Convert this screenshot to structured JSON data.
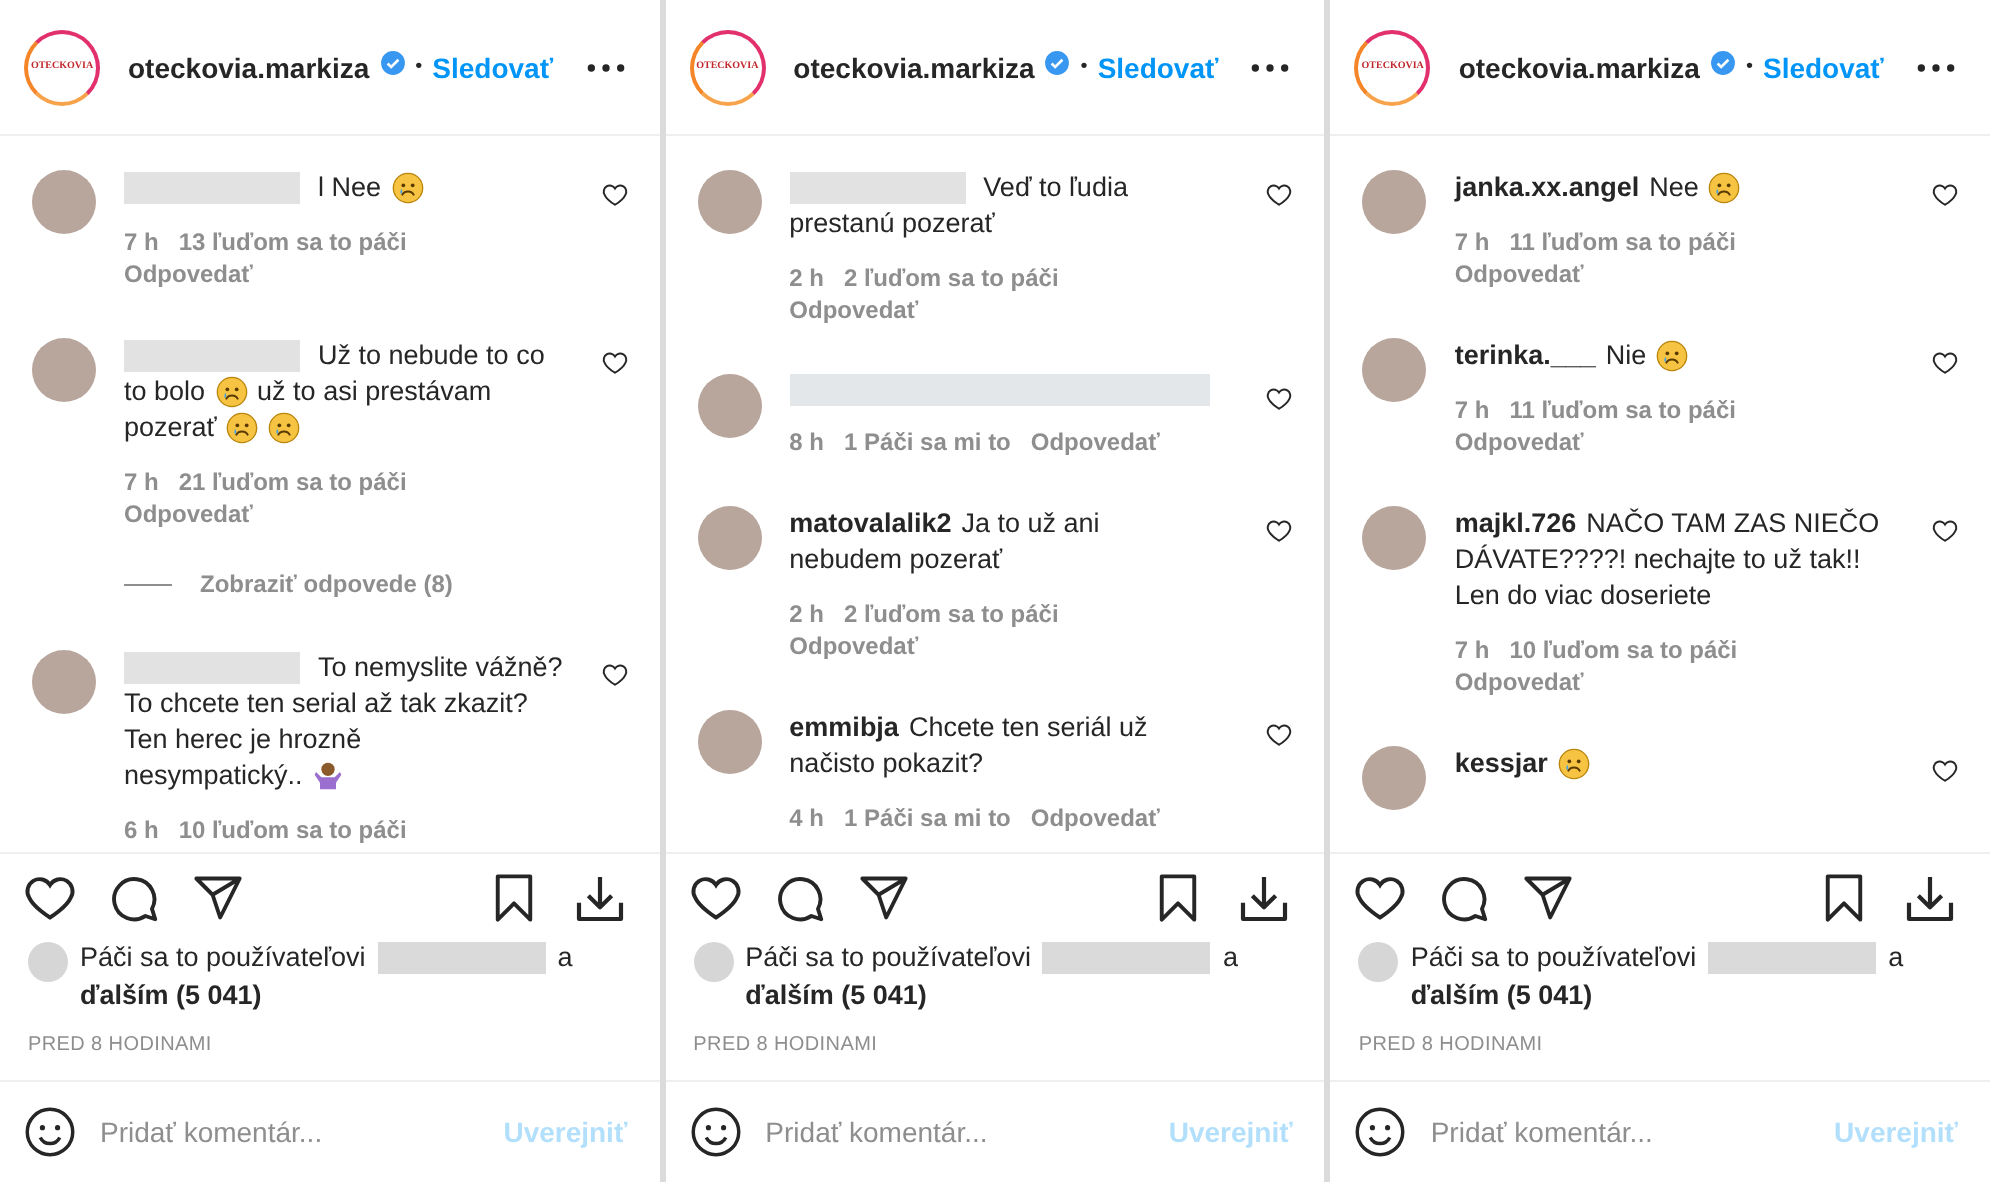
{
  "panels": [
    {
      "header": {
        "logo_text": "OTECKOVIA",
        "username": "oteckovia.markiza",
        "verified": true,
        "separator": "•",
        "follow": "Sledovať"
      },
      "comments": [
        {
          "author_hidden": true,
          "lines": [
            [
              {
                "kind": "text",
                "text": "l Nee"
              },
              {
                "kind": "emoji"
              }
            ]
          ],
          "time": "7 h",
          "likes": "13 ľuďom sa to páči",
          "reply": "Odpovedať"
        },
        {
          "author_hidden": true,
          "lines": [
            [
              {
                "kind": "text",
                "text": "Už to nebude to co"
              }
            ],
            [
              {
                "kind": "text",
                "text": "to bolo"
              },
              {
                "kind": "emoji"
              },
              {
                "kind": "text",
                "text": "už to asi prestávam"
              }
            ],
            [
              {
                "kind": "text",
                "text": "pozerať"
              },
              {
                "kind": "emoji"
              },
              {
                "kind": "emoji"
              }
            ]
          ],
          "time": "7 h",
          "likes": "21 ľuďom sa to páči",
          "reply": "Odpovedať",
          "view_replies": "Zobraziť odpovede (8)"
        },
        {
          "author_hidden": true,
          "lines": [
            [
              {
                "kind": "text",
                "text": "To nemyslite vážně?"
              }
            ],
            [
              {
                "kind": "text",
                "text": "To chcete ten serial až tak zkazit?"
              }
            ],
            [
              {
                "kind": "text",
                "text": "Ten herec je hrozně"
              }
            ],
            [
              {
                "kind": "text",
                "text": "nesympatický.."
              },
              {
                "kind": "gesture"
              }
            ]
          ],
          "time": "6 h",
          "likes": "10 ľuďom sa to páči"
        }
      ],
      "likes": {
        "prefix": "Páči sa to používateľovi",
        "joiner": "a",
        "count": "ďalším (5 041)"
      },
      "timestamp": "PRED 8 HODINAMI",
      "comment_placeholder": "Pridať komentár...",
      "post": "Uverejniť"
    },
    {
      "header": {
        "logo_text": "OTECKOVIA",
        "username": "oteckovia.markiza",
        "verified": true,
        "separator": "•",
        "follow": "Sledovať"
      },
      "comments": [
        {
          "author_hidden": true,
          "lines": [
            [
              {
                "kind": "text",
                "text": "Veď to ľudia"
              }
            ],
            [
              {
                "kind": "text",
                "text": "prestanú pozerať"
              }
            ]
          ],
          "time": "2 h",
          "likes": "2 ľuďom sa to páči",
          "reply": "Odpovedať"
        },
        {
          "author_hidden": true,
          "text_hidden": true,
          "time": "8 h",
          "likes": "1 Páči sa mi to",
          "reply": "Odpovedať"
        },
        {
          "author": "matovalalik2",
          "lines": [
            [
              {
                "kind": "text",
                "text": "Ja to už ani"
              }
            ],
            [
              {
                "kind": "text",
                "text": "nebudem pozerať"
              }
            ]
          ],
          "time": "2 h",
          "likes": "2 ľuďom sa to páči",
          "reply": "Odpovedať"
        },
        {
          "author": "emmibja",
          "lines": [
            [
              {
                "kind": "text",
                "text": "Chcete ten seriál už"
              }
            ],
            [
              {
                "kind": "text",
                "text": "načisto pokazit?"
              }
            ]
          ],
          "time": "4 h",
          "likes": "1 Páči sa mi to",
          "reply": "Odpovedať"
        }
      ],
      "likes": {
        "prefix": "Páči sa to používateľovi",
        "joiner": "a",
        "count": "ďalším (5 041)"
      },
      "timestamp": "PRED 8 HODINAMI",
      "comment_placeholder": "Pridať komentár...",
      "post": "Uverejniť"
    },
    {
      "header": {
        "logo_text": "OTECKOVIA",
        "username": "oteckovia.markiza",
        "verified": true,
        "separator": "•",
        "follow": "Sledovať"
      },
      "comments": [
        {
          "author": "janka.xx.angel",
          "lines": [
            [
              {
                "kind": "text",
                "text": "Nee"
              },
              {
                "kind": "emoji"
              }
            ]
          ],
          "time": "7 h",
          "likes": "11 ľuďom sa to páči",
          "reply": "Odpovedať"
        },
        {
          "author": "terinka.___",
          "lines": [
            [
              {
                "kind": "text",
                "text": "Nie"
              },
              {
                "kind": "emoji"
              }
            ]
          ],
          "time": "7 h",
          "likes": "11 ľuďom sa to páči",
          "reply": "Odpovedať"
        },
        {
          "author": "majkl.726",
          "lines": [
            [
              {
                "kind": "text",
                "text": "NAČO TAM ZAS NIEČO"
              }
            ],
            [
              {
                "kind": "text",
                "text": "DÁVATE????! nechajte to už tak!!"
              }
            ],
            [
              {
                "kind": "text",
                "text": "Len do viac doseriete"
              }
            ]
          ],
          "time": "7 h",
          "likes": "10 ľuďom sa to páči",
          "reply": "Odpovedať"
        },
        {
          "author": "kessjar",
          "lines": [
            [
              {
                "kind": "emoji"
              }
            ]
          ]
        }
      ],
      "likes": {
        "prefix": "Páči sa to používateľovi",
        "joiner": "a",
        "count": "ďalším (5 041)"
      },
      "timestamp": "PRED 8 HODINAMI",
      "comment_placeholder": "Pridať komentár...",
      "post": "Uverejniť"
    }
  ]
}
